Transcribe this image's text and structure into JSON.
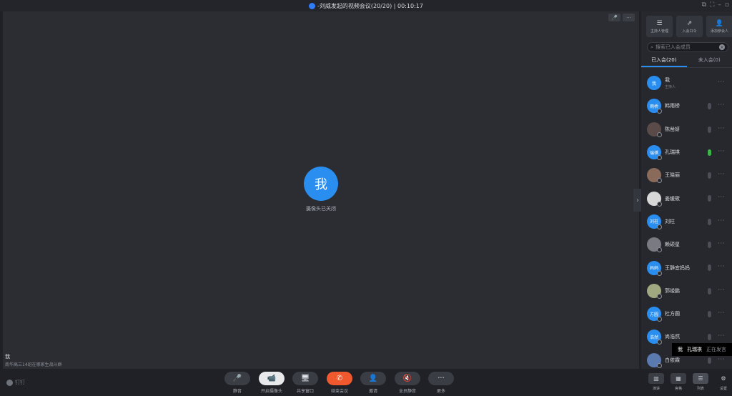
{
  "window": {
    "title": "-刘威发起的视频会议(20/20) | 00:10:17",
    "controls": [
      "⧉",
      "⛶",
      "–",
      "▫"
    ]
  },
  "main": {
    "self_avatar": "我",
    "camera_status": "摄像头已关闭",
    "self_name": "我",
    "self_note": "南华高三14班在哪家生战斗群"
  },
  "toolbar": {
    "brand": "钉钉",
    "buttons": [
      {
        "label": "静音",
        "icon": "🎤"
      },
      {
        "label": "开启摄像头",
        "icon": "📹"
      },
      {
        "label": "共享窗口",
        "icon": "🖥"
      },
      {
        "label": "结束会议",
        "icon": "✆"
      },
      {
        "label": "邀请",
        "icon": "👤"
      },
      {
        "label": "全员静音",
        "icon": "🔇"
      },
      {
        "label": "更多",
        "icon": "···"
      }
    ]
  },
  "panel": {
    "tools": [
      {
        "label": "主持人管理",
        "icon": "☰"
      },
      {
        "label": "入会口令",
        "icon": "⇗"
      },
      {
        "label": "添加参会人",
        "icon": "👤"
      }
    ],
    "search_placeholder": "搜索已入会成员",
    "tabs": [
      "已入会(20)",
      "未入会(0)"
    ],
    "members": [
      {
        "name": "我",
        "role": "主持人",
        "avatar": "我",
        "color": "#2a8ef0",
        "mic": "none"
      },
      {
        "name": "韩雨桥",
        "avatar": "雨桥",
        "color": "#2a8ef0",
        "mic": "off"
      },
      {
        "name": "陈凿妍",
        "avatar": "",
        "color": "#5a4a48",
        "mic": "off"
      },
      {
        "name": "孔瑞祺",
        "avatar": "瑞祺",
        "color": "#2a8ef0",
        "mic": "on"
      },
      {
        "name": "王晓丽",
        "avatar": "",
        "color": "#8a6a5a",
        "mic": "off"
      },
      {
        "name": "姜缓筱",
        "avatar": "",
        "color": "#d8d8d8",
        "mic": "off"
      },
      {
        "name": "刘柱",
        "avatar": "刘柱",
        "color": "#2a8ef0",
        "mic": "off"
      },
      {
        "name": "赖硕星",
        "avatar": "",
        "color": "#7a7a82",
        "mic": "off"
      },
      {
        "name": "王静宜妈妈",
        "avatar": "妈妈",
        "color": "#2a8ef0",
        "mic": "off"
      },
      {
        "name": "郭竣鹏",
        "avatar": "",
        "color": "#a0a880",
        "mic": "off"
      },
      {
        "name": "杜方圆",
        "avatar": "方圆",
        "color": "#2a8ef0",
        "mic": "off"
      },
      {
        "name": "尚浩然",
        "avatar": "浩然",
        "color": "#2a8ef0",
        "mic": "off"
      },
      {
        "name": "白依霖",
        "avatar": "",
        "color": "#5a7ab0",
        "mic": "off"
      }
    ],
    "more_glyph": "···"
  },
  "toast": {
    "speaker_prefix": "我",
    "speaker": "孔瑞祺",
    "status": "正在发言"
  },
  "panel_bottom": {
    "buttons": [
      {
        "label": "演讲",
        "icon": "▥"
      },
      {
        "label": "宫格",
        "icon": "▦"
      },
      {
        "label": "列表",
        "icon": "☰"
      },
      {
        "label": "设置",
        "icon": "⚙"
      }
    ]
  }
}
